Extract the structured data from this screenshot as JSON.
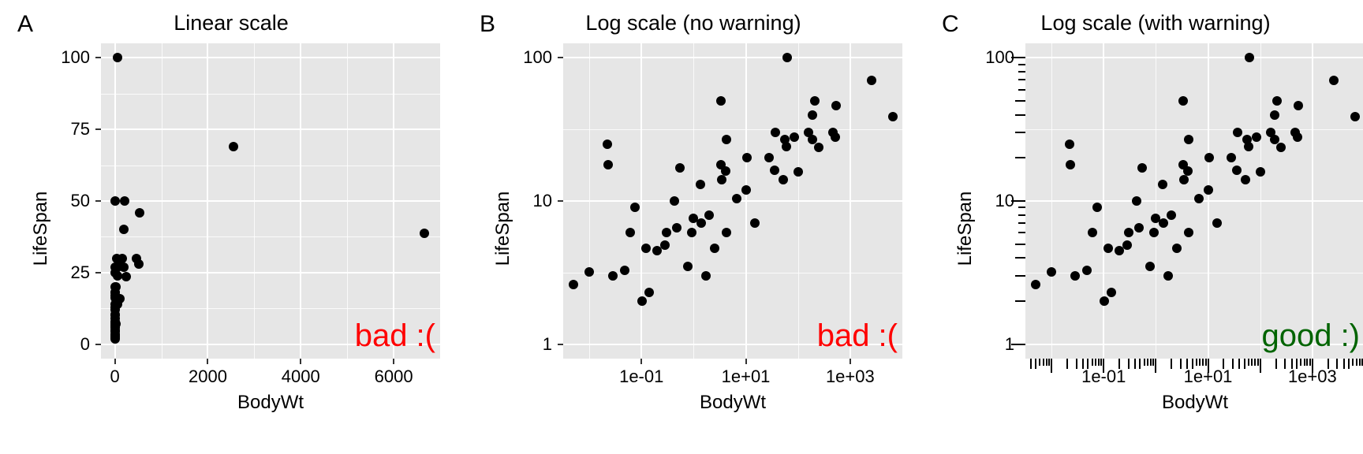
{
  "tags": {
    "A": "A",
    "B": "B",
    "C": "C"
  },
  "titles": {
    "A": "Linear scale",
    "B": "Log scale (no warning)",
    "C": "Log scale (with warning)"
  },
  "axis": {
    "x": "BodyWt",
    "y": "LifeSpan"
  },
  "annot": {
    "A": {
      "text": "bad :(",
      "color": "#ff0000"
    },
    "B": {
      "text": "bad :(",
      "color": "#ff0000"
    },
    "C": {
      "text": "good :)",
      "color": "#006400"
    }
  },
  "chart_data": [
    {
      "id": "A",
      "type": "scatter",
      "title": "Linear scale",
      "xlabel": "BodyWt",
      "ylabel": "LifeSpan",
      "xlim": [
        -300,
        7000
      ],
      "ylim": [
        -5,
        105
      ],
      "x_ticks": [
        0,
        2000,
        4000,
        6000
      ],
      "y_ticks": [
        0,
        25,
        50,
        75,
        100
      ],
      "scale": "linear",
      "annotation": {
        "text": "bad :(",
        "color": "#ff0000"
      }
    },
    {
      "id": "B",
      "type": "scatter",
      "title": "Log scale (no warning)",
      "xlabel": "BodyWt",
      "ylabel": "LifeSpan",
      "xlim_log10": [
        -2.5,
        4
      ],
      "ylim_log10": [
        -0.1,
        2.1
      ],
      "x_ticks": [
        "1e-01",
        "1e+01",
        "1e+03"
      ],
      "x_tick_vals": [
        0.1,
        10,
        1000
      ],
      "y_ticks": [
        1,
        10,
        100
      ],
      "scale": "log",
      "log_minor_ticks": false,
      "annotation": {
        "text": "bad :(",
        "color": "#ff0000"
      }
    },
    {
      "id": "C",
      "type": "scatter",
      "title": "Log scale (with warning)",
      "xlabel": "BodyWt",
      "ylabel": "LifeSpan",
      "xlim_log10": [
        -2.5,
        4
      ],
      "ylim_log10": [
        -0.1,
        2.1
      ],
      "x_ticks": [
        "1e-01",
        "1e+01",
        "1e+03"
      ],
      "x_tick_vals": [
        0.1,
        10,
        1000
      ],
      "y_ticks": [
        1,
        10,
        100
      ],
      "scale": "log",
      "log_minor_ticks": true,
      "annotation": {
        "text": "good :)",
        "color": "#006400"
      }
    }
  ],
  "shared_scatter": [
    {
      "BodyWt": 0.005,
      "LifeSpan": 2.6
    },
    {
      "BodyWt": 0.01,
      "LifeSpan": 3.2
    },
    {
      "BodyWt": 0.022,
      "LifeSpan": 25
    },
    {
      "BodyWt": 0.023,
      "LifeSpan": 18
    },
    {
      "BodyWt": 0.028,
      "LifeSpan": 3
    },
    {
      "BodyWt": 0.048,
      "LifeSpan": 3.3
    },
    {
      "BodyWt": 0.06,
      "LifeSpan": 6
    },
    {
      "BodyWt": 0.075,
      "LifeSpan": 9
    },
    {
      "BodyWt": 0.101,
      "LifeSpan": 2
    },
    {
      "BodyWt": 0.122,
      "LifeSpan": 4.7
    },
    {
      "BodyWt": 0.14,
      "LifeSpan": 2.3
    },
    {
      "BodyWt": 0.2,
      "LifeSpan": 4.5
    },
    {
      "BodyWt": 0.28,
      "LifeSpan": 4.9
    },
    {
      "BodyWt": 0.3,
      "LifeSpan": 6
    },
    {
      "BodyWt": 0.425,
      "LifeSpan": 10
    },
    {
      "BodyWt": 0.48,
      "LifeSpan": 6.5
    },
    {
      "BodyWt": 0.55,
      "LifeSpan": 17
    },
    {
      "BodyWt": 0.785,
      "LifeSpan": 3.5
    },
    {
      "BodyWt": 0.92,
      "LifeSpan": 6
    },
    {
      "BodyWt": 1,
      "LifeSpan": 7.6
    },
    {
      "BodyWt": 1.35,
      "LifeSpan": 13
    },
    {
      "BodyWt": 1.41,
      "LifeSpan": 7
    },
    {
      "BodyWt": 1.7,
      "LifeSpan": 3
    },
    {
      "BodyWt": 2,
      "LifeSpan": 8
    },
    {
      "BodyWt": 2.5,
      "LifeSpan": 4.7
    },
    {
      "BodyWt": 3.3,
      "LifeSpan": 18
    },
    {
      "BodyWt": 3.5,
      "LifeSpan": 14
    },
    {
      "BodyWt": 3.385,
      "LifeSpan": 50
    },
    {
      "BodyWt": 4.05,
      "LifeSpan": 16.2
    },
    {
      "BodyWt": 4.3,
      "LifeSpan": 6
    },
    {
      "BodyWt": 4.235,
      "LifeSpan": 27
    },
    {
      "BodyWt": 6.8,
      "LifeSpan": 10.4
    },
    {
      "BodyWt": 10,
      "LifeSpan": 12
    },
    {
      "BodyWt": 10.55,
      "LifeSpan": 20
    },
    {
      "BodyWt": 14.83,
      "LifeSpan": 7
    },
    {
      "BodyWt": 27.66,
      "LifeSpan": 20
    },
    {
      "BodyWt": 35,
      "LifeSpan": 16.3
    },
    {
      "BodyWt": 36.3,
      "LifeSpan": 30
    },
    {
      "BodyWt": 52.16,
      "LifeSpan": 14
    },
    {
      "BodyWt": 55.5,
      "LifeSpan": 27
    },
    {
      "BodyWt": 60,
      "LifeSpan": 24
    },
    {
      "BodyWt": 62,
      "LifeSpan": 100
    },
    {
      "BodyWt": 85,
      "LifeSpan": 28
    },
    {
      "BodyWt": 100,
      "LifeSpan": 16
    },
    {
      "BodyWt": 160,
      "LifeSpan": 30
    },
    {
      "BodyWt": 187.1,
      "LifeSpan": 40
    },
    {
      "BodyWt": 192,
      "LifeSpan": 27
    },
    {
      "BodyWt": 207,
      "LifeSpan": 50
    },
    {
      "BodyWt": 250,
      "LifeSpan": 23.6
    },
    {
      "BodyWt": 465,
      "LifeSpan": 30
    },
    {
      "BodyWt": 521,
      "LifeSpan": 28
    },
    {
      "BodyWt": 529,
      "LifeSpan": 46
    },
    {
      "BodyWt": 2547,
      "LifeSpan": 69
    },
    {
      "BodyWt": 6654,
      "LifeSpan": 38.6
    }
  ]
}
